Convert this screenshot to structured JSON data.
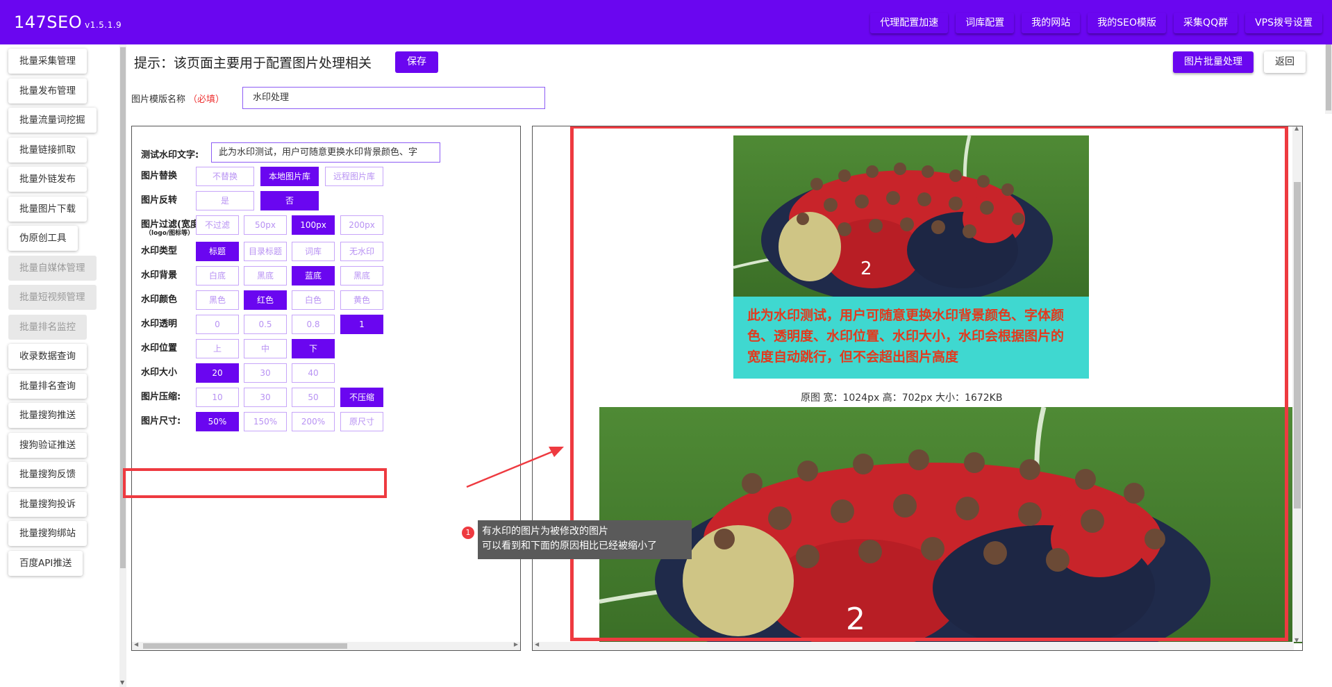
{
  "app": {
    "brand": "147SEO",
    "version": "v1.5.1.9"
  },
  "topnav": [
    {
      "label": "代理配置加速"
    },
    {
      "label": "词库配置"
    },
    {
      "label": "我的网站"
    },
    {
      "label": "我的SEO模版"
    },
    {
      "label": "采集QQ群"
    },
    {
      "label": "VPS拨号设置"
    }
  ],
  "sidebar": [
    {
      "label": "批量采集管理",
      "disabled": false
    },
    {
      "label": "批量发布管理",
      "disabled": false
    },
    {
      "label": "批量流量词挖掘",
      "disabled": false
    },
    {
      "label": "批量链接抓取",
      "disabled": false
    },
    {
      "label": "批量外链发布",
      "disabled": false
    },
    {
      "label": "批量图片下载",
      "disabled": false
    },
    {
      "label": "伪原创工具",
      "disabled": false
    },
    {
      "label": "批量自媒体管理",
      "disabled": true
    },
    {
      "label": "批量短视频管理",
      "disabled": true
    },
    {
      "label": "批量排名监控",
      "disabled": true
    },
    {
      "label": "收录数据查询",
      "disabled": false
    },
    {
      "label": "批量排名查询",
      "disabled": false
    },
    {
      "label": "批量搜狗推送",
      "disabled": false
    },
    {
      "label": "搜狗验证推送",
      "disabled": false
    },
    {
      "label": "批量搜狗反馈",
      "disabled": false
    },
    {
      "label": "批量搜狗投诉",
      "disabled": false
    },
    {
      "label": "批量搜狗绑站",
      "disabled": false
    },
    {
      "label": "百度API推送",
      "disabled": false
    }
  ],
  "header": {
    "hint": "提示：该页面主要用于配置图片处理相关",
    "save_label": "保存",
    "batch_label": "图片批量处理",
    "back_label": "返回"
  },
  "template_name": {
    "label": "图片模版名称",
    "required": "（必填）",
    "value": "水印处理"
  },
  "settings": {
    "wm_text": {
      "label": "测试水印文字:",
      "value": "此为水印测试，用户可随意更换水印背景颜色、字"
    },
    "rows": [
      {
        "label": "图片替换",
        "options": [
          "不替换",
          "本地图片库",
          "远程图片库"
        ],
        "selected": 1
      },
      {
        "label": "图片反转",
        "options": [
          "是",
          "否"
        ],
        "selected": 1
      },
      {
        "label": "图片过滤(宽度)",
        "sub": "（logo/图标等）",
        "options": [
          "不过滤",
          "50px",
          "100px",
          "200px"
        ],
        "selected": 2
      },
      {
        "label": "水印类型",
        "options": [
          "标题",
          "目录标题",
          "词库",
          "无水印"
        ],
        "selected": 0
      },
      {
        "label": "水印背景",
        "options": [
          "白底",
          "黑底",
          "蓝底",
          "黑底"
        ],
        "selected": 2
      },
      {
        "label": "水印颜色",
        "options": [
          "黑色",
          "红色",
          "白色",
          "黄色"
        ],
        "selected": 1
      },
      {
        "label": "水印透明",
        "options": [
          "0",
          "0.5",
          "0.8",
          "1"
        ],
        "selected": 3
      },
      {
        "label": "水印位置",
        "options": [
          "上",
          "中",
          "下"
        ],
        "selected": 2
      },
      {
        "label": "水印大小",
        "options": [
          "20",
          "30",
          "40"
        ],
        "selected": 0
      },
      {
        "label": "图片压缩:",
        "options": [
          "10",
          "30",
          "50",
          "不压缩"
        ],
        "selected": 3
      },
      {
        "label": "图片尺寸:",
        "options": [
          "50%",
          "150%",
          "200%",
          "原尺寸"
        ],
        "selected": 0
      }
    ]
  },
  "preview": {
    "watermark_text": "此为水印测试，用户可随意更换水印背景颜色、字体颜色、透明度、水印位置、水印大小，水印会根据图片的宽度自动跳行，但不会超出图片高度",
    "original_caption": "原图 宽：1024px 高：702px 大小：1672KB",
    "watermark_bg_color": "#3fd8d0",
    "watermark_text_color": "#e23a1e"
  },
  "annotation": {
    "number": "1",
    "line1": "有水印的图片为被修改的图片",
    "line2": "可以看到和下面的原因相比已经被缩小了"
  },
  "colors": {
    "brand": "#6a06f0",
    "highlight": "#ee3a40"
  }
}
